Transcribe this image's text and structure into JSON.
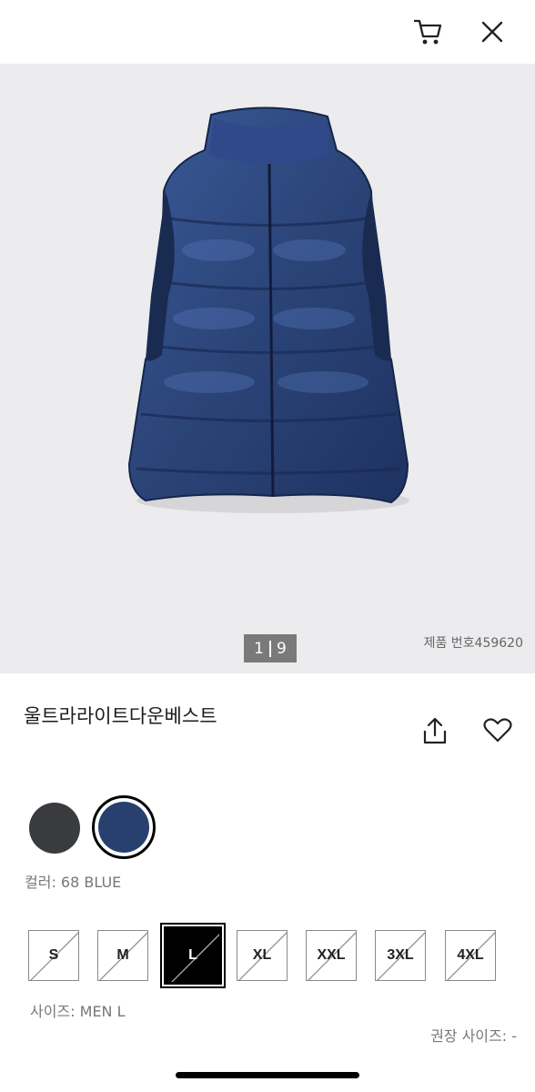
{
  "header": {
    "cart_icon": "cart-icon",
    "close_icon": "close-icon"
  },
  "gallery": {
    "current": "1",
    "total": "9",
    "product_number": "제품 번호459620",
    "image_subject": "navy-down-vest"
  },
  "product": {
    "title": "울트라라이트다운베스트",
    "share_icon": "share-icon",
    "wishlist_icon": "heart-icon"
  },
  "colors": {
    "swatches": [
      {
        "name": "dark-gray",
        "hex": "#3a3b3e"
      },
      {
        "name": "blue",
        "hex": "#27406e",
        "selected": true
      }
    ],
    "label": "컬러: 68 BLUE"
  },
  "sizes": {
    "options": [
      {
        "label": "S",
        "selected": false
      },
      {
        "label": "M",
        "selected": false
      },
      {
        "label": "L",
        "selected": true
      },
      {
        "label": "XL",
        "selected": false
      },
      {
        "label": "XXL",
        "selected": false
      },
      {
        "label": "3XL",
        "selected": false
      },
      {
        "label": "4XL",
        "selected": false
      }
    ],
    "label": "사이즈: MEN L",
    "recommended": "권장 사이즈: -"
  },
  "colors_theme": {
    "hero_bg": "#ececee",
    "vest": "#2b4173",
    "selected": "#000000"
  }
}
